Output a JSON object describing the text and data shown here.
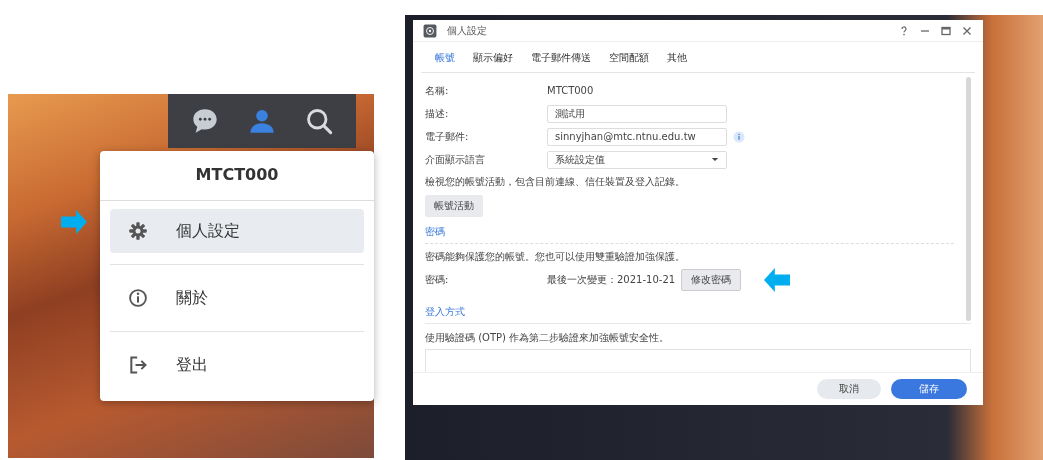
{
  "user_menu": {
    "username": "MTCT000",
    "items": [
      {
        "kind": "settings",
        "label": "個人設定",
        "selected": true
      },
      {
        "kind": "about",
        "label": "關於",
        "selected": false
      },
      {
        "kind": "logout",
        "label": "登出",
        "selected": false
      }
    ]
  },
  "window": {
    "title": "個人設定",
    "tabs": [
      {
        "label": "帳號",
        "selected": true
      },
      {
        "label": "顯示偏好",
        "selected": false
      },
      {
        "label": "電子郵件傳送",
        "selected": false
      },
      {
        "label": "空間配額",
        "selected": false
      },
      {
        "label": "其他",
        "selected": false
      }
    ],
    "fields": [
      {
        "kind": "static",
        "label": "名稱:",
        "value": "MTCT000"
      },
      {
        "kind": "input",
        "label": "描述:",
        "value": "測試用"
      },
      {
        "kind": "input_info",
        "label": "電子郵件:",
        "value": "sinnyjhan@mtc.ntnu.edu.tw"
      },
      {
        "kind": "select",
        "label": "介面顯示語言",
        "value": "系統設定值"
      }
    ],
    "activity_text": "檢視您的帳號活動，包含目前連線、信任裝置及登入記錄。",
    "activity_button": "帳號活動",
    "password_section": {
      "heading": "密碼",
      "text": "密碼能夠保護您的帳號。您也可以使用雙重驗證加強保護。",
      "label": "密碼:",
      "last_changed": "最後一次變更：2021-10-21",
      "button": "修改密碼"
    },
    "login_section": {
      "heading": "登入方式",
      "text": "使用驗證碼 (OTP) 作為第二步驗證來加強帳號安全性。"
    },
    "buttons": [
      {
        "kind": "secondary",
        "label": "取消"
      },
      {
        "kind": "primary",
        "label": "儲存"
      }
    ]
  }
}
